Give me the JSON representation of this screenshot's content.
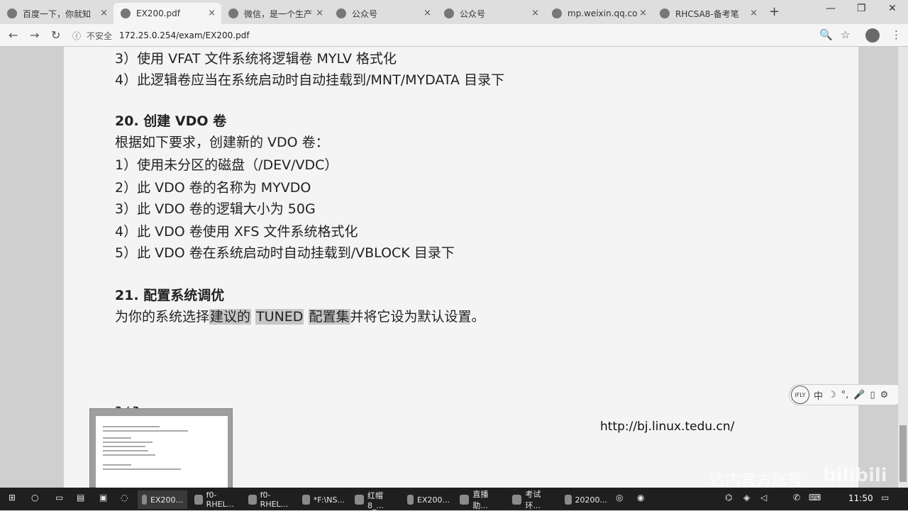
{
  "browser": {
    "tabs": [
      {
        "label": "百度一下，你就知",
        "icon": "paw-icon"
      },
      {
        "label": "EX200.pdf",
        "icon": "globe-icon",
        "active": true
      },
      {
        "label": "微信，是一个生产",
        "icon": "wechat-icon"
      },
      {
        "label": "公众号",
        "icon": "loading-icon"
      },
      {
        "label": "公众号",
        "icon": "loading-icon"
      },
      {
        "label": "mp.weixin.qq.co",
        "icon": "wechat-icon"
      },
      {
        "label": "RHCSA8-备考笔",
        "icon": "app-icon"
      }
    ],
    "tab_close": "×",
    "new_tab": "+",
    "minimize": "—",
    "maximize": "❐",
    "close": "✕",
    "back": "←",
    "forward": "→",
    "reload": "↻",
    "security_label": "不安全",
    "url": "172.25.0.254/exam/EX200.pdf",
    "zoom_icon": "🔍",
    "star_icon": "☆",
    "menu_icon": "⋮"
  },
  "document": {
    "prev_items": [
      "3）使用 VFAT 文件系统将逻辑卷 MYLV 格式化",
      "4）此逻辑卷应当在系统启动时自动挂载到/MNT/MYDATA 目录下"
    ],
    "section20": {
      "title": "20. 创建 VDO 卷",
      "intro": "根据如下要求，创建新的 VDO 卷：",
      "items": [
        "1）使用未分区的磁盘（/DEV/VDC）",
        "2）此 VDO 卷的名称为 MYVDO",
        "3）此 VDO 卷的逻辑大小为 50G",
        "4）此 VDO 卷使用 XFS 文件系统格式化",
        "5）此 VDO 卷在系统启动时自动挂载到/VBLOCK 目录下"
      ]
    },
    "section21": {
      "title": "21. 配置系统调优",
      "text_before": "为你的系统选择",
      "hl1": "建议的",
      "hl2": "TUNED",
      "hl3": "配置集",
      "text_after": "并将它设为默认设置。"
    },
    "page_number": "3 / 3",
    "footer_link": "http://bj.linux.tedu.cn/"
  },
  "ime_bar": {
    "logo": "iFLY",
    "items": [
      "中",
      "☽",
      "°,",
      "🎤",
      "▯",
      "⚙"
    ]
  },
  "watermark": {
    "text1": "达内官方账号",
    "text2": "bilibili"
  },
  "taskbar": {
    "tasks": [
      {
        "label": "EX200...",
        "active": true
      },
      {
        "label": "f0-RHEL..."
      },
      {
        "label": "f0-RHEL..."
      },
      {
        "label": "*F:\\NS..."
      },
      {
        "label": "红帽8_..."
      },
      {
        "label": "EX200..."
      },
      {
        "label": "直播助..."
      },
      {
        "label": "考试环..."
      },
      {
        "label": "20200..."
      }
    ],
    "clock": "11:50"
  }
}
